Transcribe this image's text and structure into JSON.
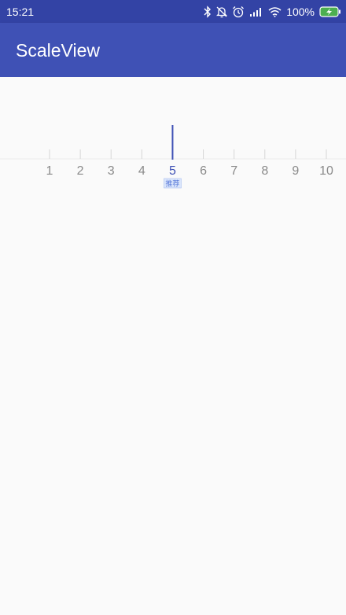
{
  "status_bar": {
    "time": "15:21",
    "battery_percent": "100%",
    "icons": [
      "bluetooth-icon",
      "bell-off-icon",
      "alarm-icon",
      "signal-icon",
      "wifi-icon",
      "battery-charging-icon"
    ]
  },
  "app_bar": {
    "title": "ScaleView"
  },
  "scale": {
    "labels": [
      "1",
      "2",
      "3",
      "4",
      "5",
      "6",
      "7",
      "8",
      "9",
      "10"
    ],
    "min": 1,
    "max": 10,
    "selected": 5,
    "badge": "推荐",
    "colors": {
      "gradient_start": "#5c7cf0",
      "gradient_end": "#e23b3b",
      "indicator": "#3f51b5",
      "label": "#8a8a8a",
      "selected_label": "#3f51b5",
      "tick": "#d6d6d6",
      "badge_bg": "#dbe6fb",
      "badge_text": "#5677d8"
    }
  }
}
